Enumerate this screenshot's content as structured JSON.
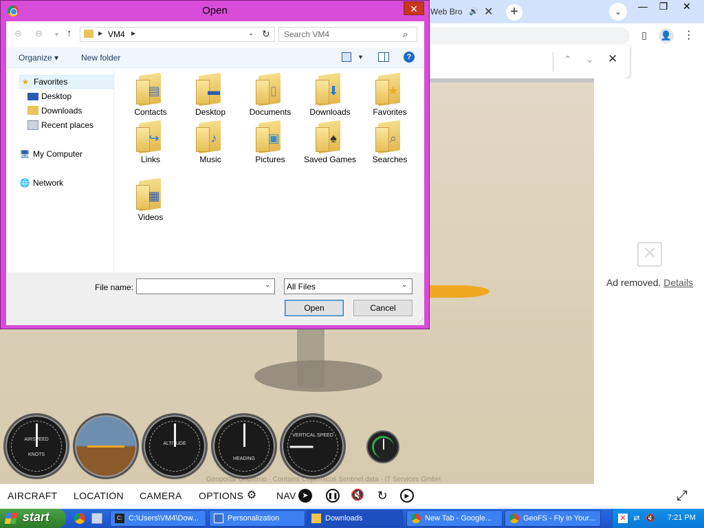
{
  "browser": {
    "tab_partial_title": "Web Bro",
    "tab_close": "✕",
    "newtab": "+",
    "tablist": "⌄",
    "win_min": "—",
    "win_max": "❐",
    "win_close": "✕",
    "menu": "⋮",
    "find_prev": "⌃",
    "find_next": "⌄",
    "find_close": "✕"
  },
  "ad": {
    "text": "Ad removed.",
    "details": "Details"
  },
  "game": {
    "attribution": "Geoportal Gobierno · Contains Copernicus Sentinel data · IT Services GmbH",
    "gauges": {
      "airspeed_top": "AIRSPEED",
      "airspeed_unit": "KNOTS",
      "altimeter": "ALTITUDE",
      "heading": "HEADING",
      "vsi": "VERTICAL SPEED"
    }
  },
  "geofs_nav": {
    "aircraft": "AIRCRAFT",
    "location": "LOCATION",
    "camera": "CAMERA",
    "options": "OPTIONS",
    "nav": "NAV"
  },
  "dialog": {
    "title": "Open",
    "close": "✕",
    "path_crumb": "VM4",
    "search_placeholder": "Search VM4",
    "organize": "Organize ▾",
    "new_folder": "New folder",
    "help": "?",
    "tree": {
      "favorites": "Favorites",
      "desktop": "Desktop",
      "downloads": "Downloads",
      "recent": "Recent places",
      "my_computer": "My Computer",
      "network": "Network"
    },
    "folders": [
      "Contacts",
      "Desktop",
      "Documents",
      "Downloads",
      "Favorites",
      "Links",
      "Music",
      "Pictures",
      "Saved Games",
      "Searches",
      "Videos"
    ],
    "file_name_label": "File name:",
    "file_name_value": "",
    "file_type": "All Files",
    "open_button": "Open",
    "cancel_button": "Cancel"
  },
  "taskbar": {
    "start": "start",
    "tasks": [
      "C:\\Users\\VM4\\Dow...",
      "Personalization",
      "Downloads",
      "New Tab - Google...",
      "GeoFS - Fly in Your..."
    ],
    "clock": "7:21 PM"
  },
  "colors": {
    "dialog_frame": "#d94cd9",
    "close_red": "#c7381f",
    "taskbar_blue": "#245edb",
    "start_green": "#3c8f36"
  }
}
